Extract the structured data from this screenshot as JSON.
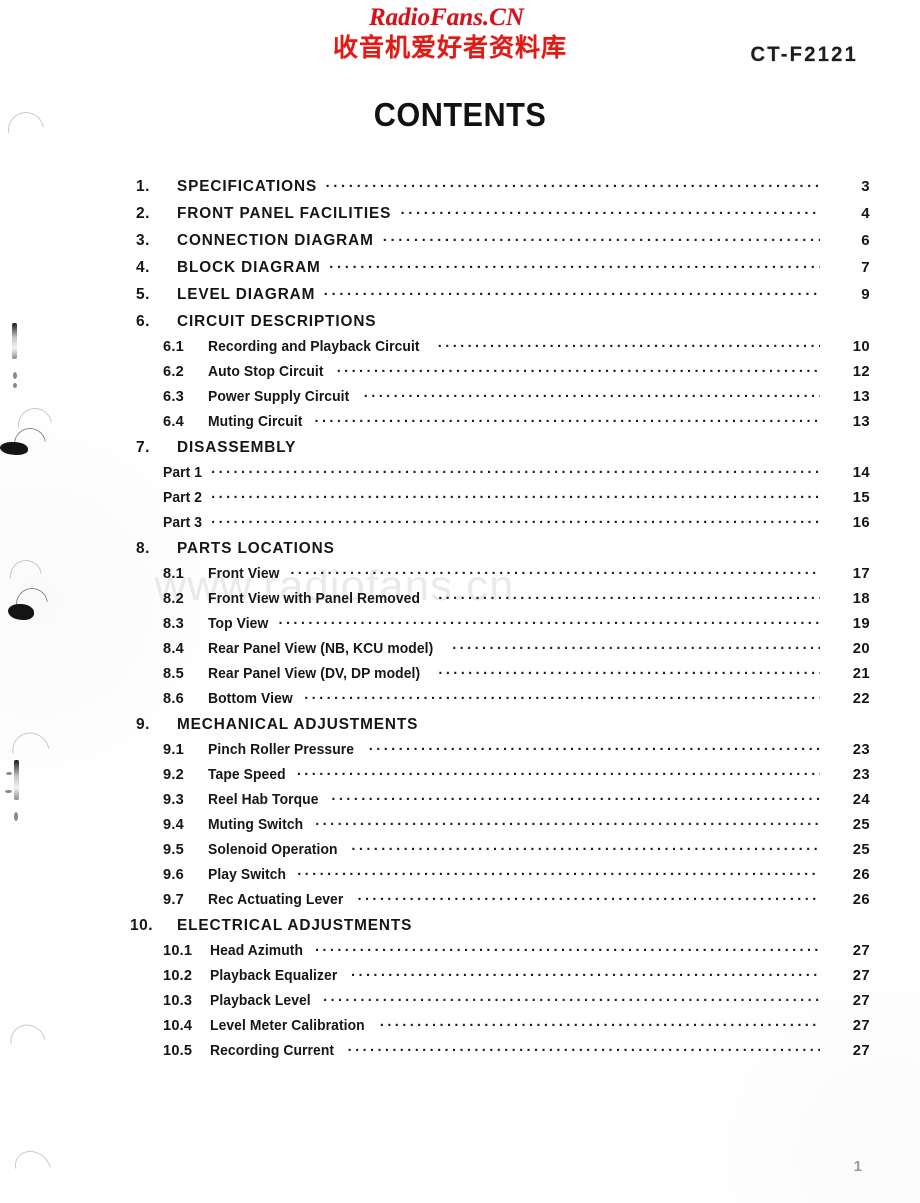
{
  "brand": {
    "latin": "RadioFans.CN",
    "cjk": "收音机爱好者资料库",
    "color": "#d3121a"
  },
  "model_number": "CT-F2121",
  "page_title": "CONTENTS",
  "watermark": "www.radiofans.cn",
  "folio": "1",
  "toc": {
    "rows": [
      {
        "level": 1,
        "num": "1.",
        "label": "SPECIFICATIONS",
        "page": "3",
        "leader": true
      },
      {
        "level": 1,
        "num": "2.",
        "label": "FRONT PANEL FACILITIES",
        "page": "4",
        "leader": true
      },
      {
        "level": 1,
        "num": "3.",
        "label": "CONNECTION DIAGRAM",
        "page": "6",
        "leader": true
      },
      {
        "level": 1,
        "num": "4.",
        "label": "BLOCK DIAGRAM",
        "page": "7",
        "leader": true
      },
      {
        "level": 1,
        "num": "5.",
        "label": "LEVEL DIAGRAM",
        "page": "9",
        "leader": true
      },
      {
        "level": 1,
        "num": "6.",
        "label": "CIRCUIT DESCRIPTIONS",
        "page": "",
        "leader": false
      },
      {
        "level": 2,
        "num": "6.1",
        "label": "Recording and Playback Circuit",
        "page": "10",
        "leader": true
      },
      {
        "level": 2,
        "num": "6.2",
        "label": "Auto Stop Circuit",
        "page": "12",
        "leader": true
      },
      {
        "level": 2,
        "num": "6.3",
        "label": "Power Supply Circuit",
        "page": "13",
        "leader": true
      },
      {
        "level": 2,
        "num": "6.4",
        "label": "Muting Circuit",
        "page": "13",
        "leader": true
      },
      {
        "level": 1,
        "num": "7.",
        "label": "DISASSEMBLY",
        "page": "",
        "leader": false
      },
      {
        "level": 2,
        "num": "",
        "label": "Part 1",
        "page": "14",
        "leader": true
      },
      {
        "level": 2,
        "num": "",
        "label": "Part 2",
        "page": "15",
        "leader": true
      },
      {
        "level": 2,
        "num": "",
        "label": "Part 3",
        "page": "16",
        "leader": true
      },
      {
        "level": 1,
        "num": "8.",
        "label": "PARTS LOCATIONS",
        "page": "",
        "leader": false
      },
      {
        "level": 2,
        "num": "8.1",
        "label": "Front View",
        "page": "17",
        "leader": true
      },
      {
        "level": 2,
        "num": "8.2",
        "label": "Front View with Panel Removed",
        "page": "18",
        "leader": true
      },
      {
        "level": 2,
        "num": "8.3",
        "label": "Top View",
        "page": "19",
        "leader": true
      },
      {
        "level": 2,
        "num": "8.4",
        "label": "Rear Panel View (NB, KCU model)",
        "page": "20",
        "leader": true
      },
      {
        "level": 2,
        "num": "8.5",
        "label": "Rear Panel View (DV, DP model)",
        "page": "21",
        "leader": true
      },
      {
        "level": 2,
        "num": "8.6",
        "label": "Bottom View",
        "page": "22",
        "leader": true
      },
      {
        "level": 1,
        "num": "9.",
        "label": "MECHANICAL ADJUSTMENTS",
        "page": "",
        "leader": false
      },
      {
        "level": 2,
        "num": "9.1",
        "label": "Pinch Roller Pressure",
        "page": "23",
        "leader": true
      },
      {
        "level": 2,
        "num": "9.2",
        "label": "Tape Speed",
        "page": "23",
        "leader": true
      },
      {
        "level": 2,
        "num": "9.3",
        "label": "Reel Hab Torque",
        "page": "24",
        "leader": true
      },
      {
        "level": 2,
        "num": "9.4",
        "label": "Muting Switch",
        "page": "25",
        "leader": true
      },
      {
        "level": 2,
        "num": "9.5",
        "label": "Solenoid Operation",
        "page": "25",
        "leader": true
      },
      {
        "level": 2,
        "num": "9.6",
        "label": "Play Switch",
        "page": "26",
        "leader": true
      },
      {
        "level": 2,
        "num": "9.7",
        "label": "Rec Actuating Lever",
        "page": "26",
        "leader": true
      },
      {
        "level": 1,
        "num": "10.",
        "label": "ELECTRICAL ADJUSTMENTS",
        "page": "",
        "leader": false,
        "wide": true
      },
      {
        "level": 2,
        "num": "10.1",
        "label": "Head Azimuth",
        "page": "27",
        "leader": true,
        "wide": true
      },
      {
        "level": 2,
        "num": "10.2",
        "label": "Playback Equalizer",
        "page": "27",
        "leader": true,
        "wide": true
      },
      {
        "level": 2,
        "num": "10.3",
        "label": "Playback Level",
        "page": "27",
        "leader": true,
        "wide": true
      },
      {
        "level": 2,
        "num": "10.4",
        "label": "Level Meter Calibration",
        "page": "27",
        "leader": true,
        "wide": true
      },
      {
        "level": 2,
        "num": "10.5",
        "label": "Recording Current",
        "page": "27",
        "leader": true,
        "wide": true
      }
    ]
  }
}
